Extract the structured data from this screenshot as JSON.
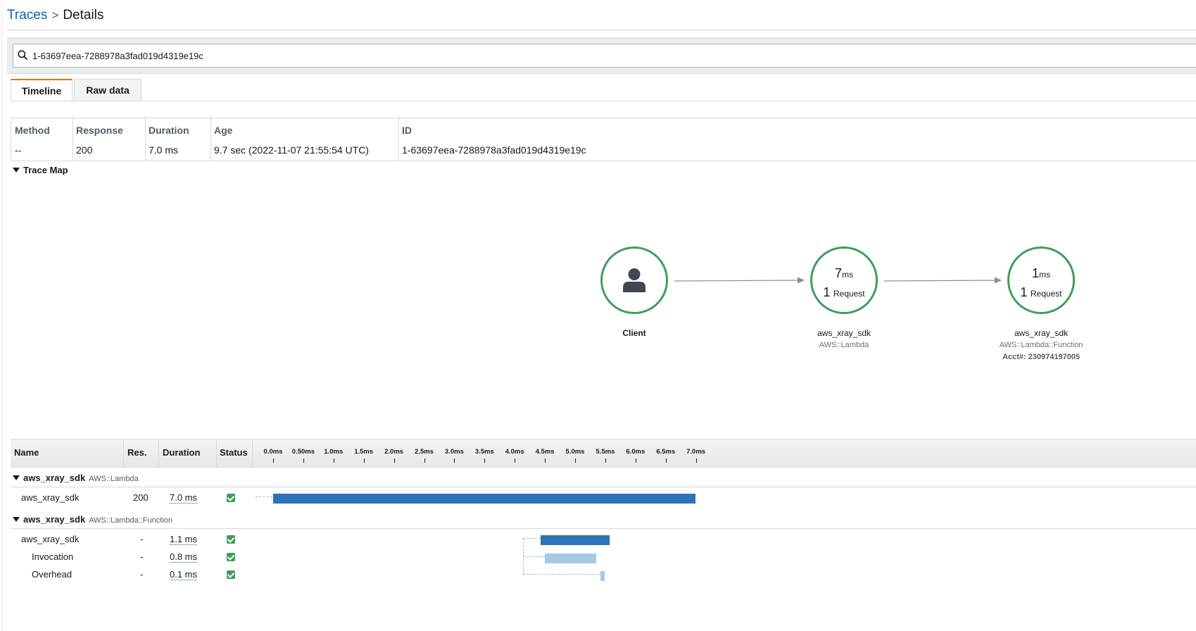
{
  "breadcrumb": {
    "parent": "Traces",
    "separator": ">",
    "current": "Details"
  },
  "search": {
    "value": "1-63697eea-7288978a3fad019d4319e19c",
    "icon": "search-icon"
  },
  "tabs": [
    {
      "label": "Timeline",
      "active": true
    },
    {
      "label": "Raw data",
      "active": false
    }
  ],
  "summary": {
    "headers": {
      "method": "Method",
      "response": "Response",
      "duration": "Duration",
      "age": "Age",
      "id": "ID"
    },
    "values": {
      "method": "--",
      "response": "200",
      "duration": "7.0 ms",
      "age": "9.7 sec (2022-11-07 21:55:54 UTC)",
      "id": "1-63697eea-7288978a3fad019d4319e19c"
    }
  },
  "trace_map": {
    "label": "Trace Map",
    "nodes": {
      "client": {
        "name": "Client",
        "icon": "user-icon"
      },
      "lambda": {
        "time": "7",
        "time_unit": "ms",
        "requests": "1",
        "requests_unit": "Request",
        "name": "aws_xray_sdk",
        "type": "AWS::Lambda"
      },
      "function": {
        "time": "1",
        "time_unit": "ms",
        "requests": "1",
        "requests_unit": "Request",
        "name": "aws_xray_sdk",
        "type": "AWS::Lambda::Function",
        "account": "Acct#: 230974197005"
      }
    }
  },
  "segments": {
    "headers": {
      "name": "Name",
      "res": "Res.",
      "duration": "Duration",
      "status": "Status"
    },
    "ticks": [
      "0.0ms",
      "0.50ms",
      "1.0ms",
      "1.5ms",
      "2.0ms",
      "2.5ms",
      "3.0ms",
      "3.5ms",
      "4.0ms",
      "4.5ms",
      "5.0ms",
      "5.5ms",
      "6.0ms",
      "6.5ms",
      "7.0ms"
    ],
    "groups": [
      {
        "name": "aws_xray_sdk",
        "type": "AWS::Lambda",
        "rows": [
          {
            "name": "aws_xray_sdk",
            "res": "200",
            "duration": "7.0 ms",
            "status": "ok"
          }
        ]
      },
      {
        "name": "aws_xray_sdk",
        "type": "AWS::Lambda::Function",
        "rows": [
          {
            "name": "aws_xray_sdk",
            "res": "-",
            "duration": "1.1 ms",
            "status": "ok"
          },
          {
            "name": "Invocation",
            "res": "-",
            "duration": "0.8 ms",
            "status": "ok"
          },
          {
            "name": "Overhead",
            "res": "-",
            "duration": "0.1 ms",
            "status": "ok"
          }
        ]
      }
    ]
  },
  "colors": {
    "accent": "#ec7211",
    "link": "#0b64b4",
    "node_ok": "#3e9e5b",
    "bar_primary": "#2e73b8",
    "bar_subsegment": "#a7c8e6"
  }
}
